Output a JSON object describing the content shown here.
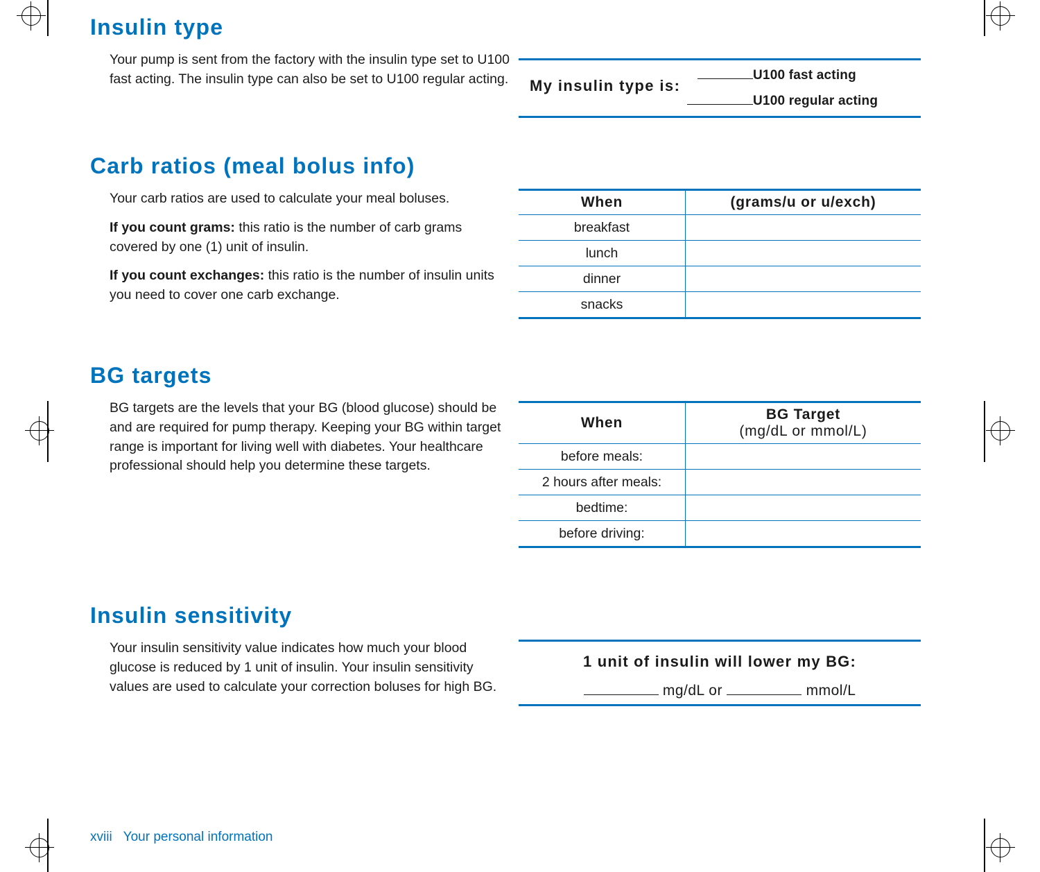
{
  "sections": {
    "insulin_type": {
      "title": "Insulin type",
      "paragraph": "Your pump is sent from the factory with the insulin type set to U100 fast acting. The insulin type can also be set to U100 regular acting.",
      "box": {
        "label": "My insulin type is:",
        "option1": "U100 fast acting",
        "option2": "U100 regular acting"
      }
    },
    "carb_ratios": {
      "title": "Carb ratios (meal bolus info)",
      "paragraph1": "Your carb ratios are used to calculate your meal boluses.",
      "paragraph2_bold": "If you count grams:",
      "paragraph2_rest": " this ratio is the number of carb grams covered by one (1) unit of insulin.",
      "paragraph3_bold": "If you count exchanges:",
      "paragraph3_rest": " this ratio is the number of insulin units you need to cover one carb exchange.",
      "table": {
        "headers": [
          "When",
          "(grams/u or u/exch)"
        ],
        "rows": [
          {
            "when": "breakfast",
            "value": ""
          },
          {
            "when": "lunch",
            "value": ""
          },
          {
            "when": "dinner",
            "value": ""
          },
          {
            "when": "snacks",
            "value": ""
          }
        ]
      }
    },
    "bg_targets": {
      "title": "BG targets",
      "paragraph": "BG targets are the levels that your BG (blood glucose) should be and are required for pump therapy. Keeping your BG within target range is important for living well with diabetes. Your healthcare professional should help you determine these targets.",
      "table": {
        "header_when": "When",
        "header_target_line1": "BG Target",
        "header_target_line2": "(mg/dL or mmol/L)",
        "rows": [
          {
            "when": "before meals:",
            "value": ""
          },
          {
            "when": "2 hours after meals:",
            "value": ""
          },
          {
            "when": "bedtime:",
            "value": ""
          },
          {
            "when": "before driving:",
            "value": ""
          }
        ]
      }
    },
    "insulin_sensitivity": {
      "title": "Insulin sensitivity",
      "paragraph": "Your insulin sensitivity value indicates how much your blood glucose is reduced by 1 unit of insulin. Your insulin sensitivity values are used to calculate your correction boluses for high BG.",
      "box": {
        "heading": "1 unit of insulin will lower my BG:",
        "unit1": "mg/dL or",
        "unit2": "mmol/L"
      }
    }
  },
  "footer": {
    "page_number": "xviii",
    "label": "Your personal information"
  },
  "colors": {
    "accent": "#0073bd",
    "text": "#1a1a1a"
  }
}
